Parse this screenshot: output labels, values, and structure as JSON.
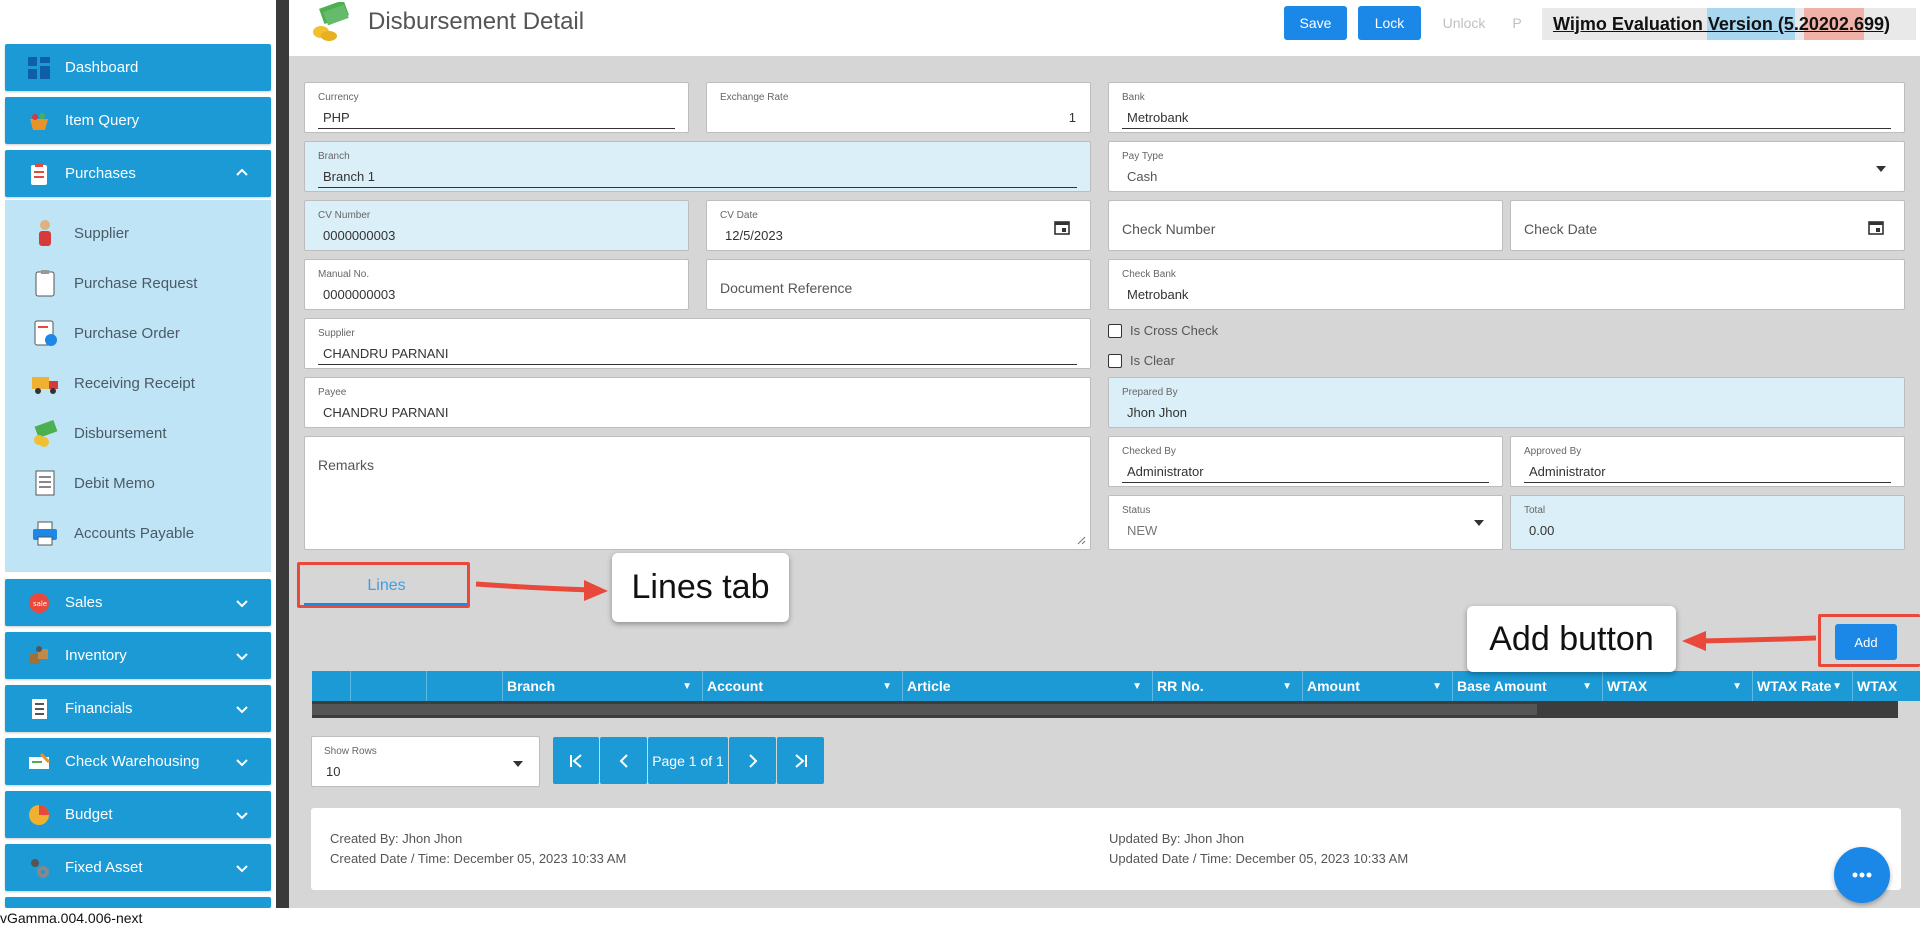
{
  "app": {
    "version": "vGamma.004.006-next"
  },
  "sidebar": {
    "items": [
      {
        "label": "Dashboard",
        "icon": "dashboard-icon"
      },
      {
        "label": "Item Query",
        "icon": "basket-icon"
      },
      {
        "label": "Purchases",
        "icon": "clipboard-icon",
        "expanded": true
      },
      {
        "label": "Sales",
        "icon": "sale-tag-icon"
      },
      {
        "label": "Inventory",
        "icon": "boxes-icon"
      },
      {
        "label": "Financials",
        "icon": "ledger-icon"
      },
      {
        "label": "Check Warehousing",
        "icon": "check-icon"
      },
      {
        "label": "Budget",
        "icon": "pie-icon"
      },
      {
        "label": "Fixed Asset",
        "icon": "gear-people-icon"
      }
    ],
    "purchases_sub": [
      {
        "label": "Supplier",
        "icon": "person-icon"
      },
      {
        "label": "Purchase Request",
        "icon": "clipboard-icon"
      },
      {
        "label": "Purchase Order",
        "icon": "order-icon"
      },
      {
        "label": "Receiving Receipt",
        "icon": "truck-icon"
      },
      {
        "label": "Disbursement",
        "icon": "money-icon"
      },
      {
        "label": "Debit Memo",
        "icon": "memo-icon"
      },
      {
        "label": "Accounts Payable",
        "icon": "printer-icon"
      }
    ]
  },
  "header": {
    "title": "Disbursement Detail",
    "save": "Save",
    "lock": "Lock",
    "unlock": "Unlock",
    "print": "P",
    "wijmo": "Wijmo Evaluation Version (5.20202.699)"
  },
  "form": {
    "currency": {
      "label": "Currency",
      "value": "PHP"
    },
    "exchange_rate": {
      "label": "Exchange Rate",
      "value": "1"
    },
    "bank": {
      "label": "Bank",
      "value": "Metrobank"
    },
    "branch": {
      "label": "Branch",
      "value": "Branch 1"
    },
    "pay_type": {
      "label": "Pay Type",
      "value": "Cash"
    },
    "cv_number": {
      "label": "CV Number",
      "value": "0000000003"
    },
    "cv_date": {
      "label": "CV Date",
      "value": "12/5/2023"
    },
    "check_number": {
      "placeholder": "Check Number"
    },
    "check_date": {
      "placeholder": "Check Date"
    },
    "manual_no": {
      "label": "Manual No.",
      "value": "0000000003"
    },
    "document_reference": {
      "placeholder": "Document Reference"
    },
    "check_bank": {
      "label": "Check Bank",
      "value": "Metrobank"
    },
    "supplier": {
      "label": "Supplier",
      "value": "CHANDRU PARNANI"
    },
    "is_cross_check": "Is Cross Check",
    "is_clear": "Is Clear",
    "payee": {
      "label": "Payee",
      "value": "CHANDRU PARNANI"
    },
    "prepared_by": {
      "label": "Prepared By",
      "value": "Jhon Jhon"
    },
    "remarks": {
      "placeholder": "Remarks"
    },
    "checked_by": {
      "label": "Checked By",
      "value": "Administrator"
    },
    "approved_by": {
      "label": "Approved By",
      "value": "Administrator"
    },
    "status": {
      "label": "Status",
      "value": "NEW"
    },
    "total": {
      "label": "Total",
      "value": "0.00"
    }
  },
  "tabs": {
    "lines": "Lines"
  },
  "annotations": {
    "lines_tab": "Lines tab",
    "add_button": "Add button"
  },
  "grid": {
    "add": "Add",
    "columns": [
      "Branch",
      "Account",
      "Article",
      "RR No.",
      "Amount",
      "Base Amount",
      "WTAX",
      "WTAX Rate",
      "WTAX"
    ]
  },
  "pager": {
    "show_rows_label": "Show Rows",
    "show_rows_value": "10",
    "page_text": "Page 1 of 1"
  },
  "footer": {
    "created_by": "Created By: Jhon Jhon",
    "created_date": "Created Date / Time: December 05, 2023 10:33 AM",
    "updated_by": "Updated By: Jhon Jhon",
    "updated_date": "Updated Date / Time: December 05, 2023 10:33 AM"
  },
  "colors": {
    "primary": "#1b9ad6",
    "button": "#1b87e6",
    "annotation": "#e8493a"
  }
}
